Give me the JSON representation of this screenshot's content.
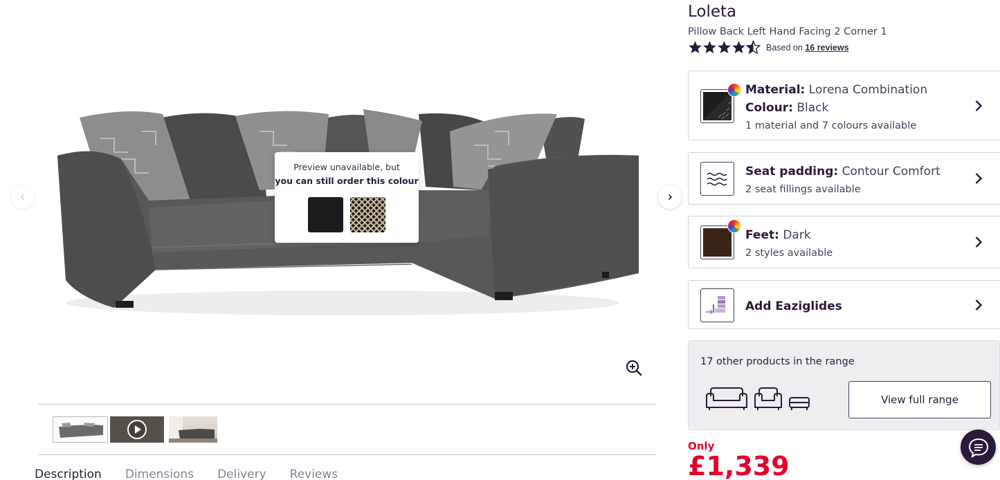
{
  "gallery": {
    "preview": {
      "line1": "Preview unavailable, but",
      "line2": "you can still order this colour"
    },
    "thumbnails": [
      "sofa-image",
      "video",
      "room-image"
    ],
    "tabs": [
      "Description",
      "Dimensions",
      "Delivery",
      "Reviews"
    ]
  },
  "product": {
    "title": "Loleta",
    "subtitle": "Pillow Back Left Hand Facing 2 Corner 1",
    "rating": 4.5,
    "rating_max": 5,
    "reviews_prefix": "Based on",
    "reviews_link": "16 reviews"
  },
  "options": {
    "material": {
      "material_key": "Material:",
      "material_value": "Lorena Combination",
      "colour_key": "Colour:",
      "colour_value": "Black",
      "sub": "1 material and 7 colours available"
    },
    "seat": {
      "key": "Seat padding:",
      "value": "Contour Comfort",
      "sub": "2 seat fillings available"
    },
    "feet": {
      "key": "Feet:",
      "value": "Dark",
      "sub": "2 styles available"
    },
    "glides": {
      "label": "Add Eaziglides"
    }
  },
  "range": {
    "text": "17 other products in the range",
    "button": "View full range"
  },
  "price": {
    "label": "Only",
    "value": "£1,339"
  },
  "colors": {
    "brand": "#2b1a3a",
    "price": "#e4002b",
    "swatch_feet": "#3a2418"
  }
}
